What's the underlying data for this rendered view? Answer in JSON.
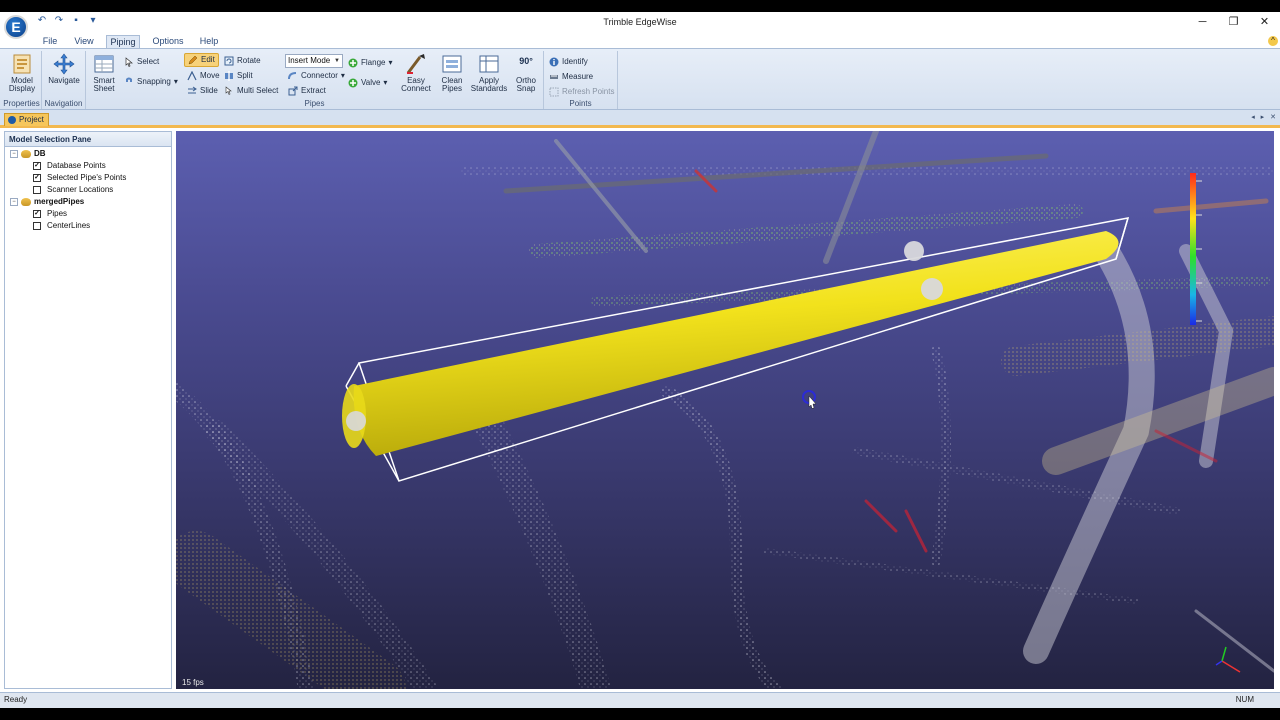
{
  "window": {
    "title": "Trimble EdgeWise",
    "logo_letter": "E",
    "controls": [
      "─",
      "❐",
      "✕"
    ]
  },
  "qat": {
    "undo_icon": "↶",
    "redo_icon": "↷",
    "save_icon": "▪",
    "customize_icon": "▾"
  },
  "menu": {
    "tabs": [
      "File",
      "View",
      "Piping",
      "Options",
      "Help"
    ],
    "active": "Piping"
  },
  "ribbon": {
    "properties": {
      "label": "Properties",
      "model_display": "Model Display"
    },
    "navigation": {
      "label": "Navigation",
      "navigate": "Navigate"
    },
    "pipes": {
      "label": "Pipes",
      "smart_sheet": "Smart Sheet",
      "select": "Select",
      "snapping": "Snapping",
      "edit": "Edit",
      "move": "Move",
      "slide": "Slide",
      "rotate": "Rotate",
      "split": "Split",
      "multi_select": "Multi Select",
      "insert_mode": "Insert Mode",
      "connector": "Connector",
      "extract": "Extract",
      "flange": "Flange",
      "valve": "Valve",
      "easy_connect": "Easy Connect",
      "clean_pipes": "Clean Pipes",
      "apply_standards": "Apply Standards",
      "ortho_snap": "Ortho Snap",
      "ortho_badge": "90°"
    },
    "points": {
      "label": "Points",
      "identify": "Identify",
      "measure": "Measure",
      "refresh_points": "Refresh Points"
    }
  },
  "doc_tab": {
    "label": "Project",
    "controls": "◂ ▸ ✕"
  },
  "pane": {
    "title": "Model Selection Pane",
    "nodes": [
      {
        "label": "DB",
        "children": [
          {
            "label": "Database Points",
            "checked": true
          },
          {
            "label": "Selected Pipe's Points",
            "checked": true
          },
          {
            "label": "Scanner Locations",
            "checked": false
          }
        ]
      },
      {
        "label": "mergedPipes",
        "children": [
          {
            "label": "Pipes",
            "checked": true
          },
          {
            "label": "CenterLines",
            "checked": false
          }
        ]
      }
    ]
  },
  "viewport": {
    "fps": "15 fps",
    "pipe_color": "#f2e21c",
    "background_color": "#4a4b91"
  },
  "status": {
    "left": "Ready",
    "right": "NUM"
  }
}
